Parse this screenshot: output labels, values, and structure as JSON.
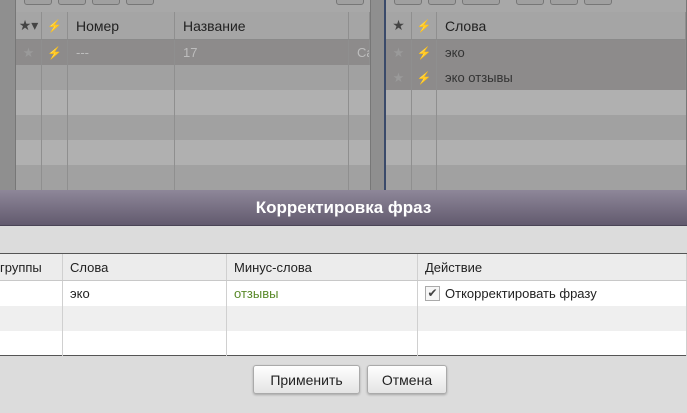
{
  "left_grid": {
    "headers": {
      "star": "★▾",
      "bolt": "⚡",
      "number": "Номер",
      "name": "Название"
    },
    "rows": [
      {
        "number": "---",
        "name": "17",
        "extra": "Ca"
      }
    ]
  },
  "right_grid": {
    "headers": {
      "star": "★",
      "bolt": "⚡",
      "words": "Слова"
    },
    "rows": [
      {
        "words": "эко"
      },
      {
        "words": "эко отзывы"
      }
    ]
  },
  "dialog": {
    "title": "Корректировка фраз",
    "columns": [
      "группы",
      "Слова",
      "Минус-слова",
      "Действие"
    ],
    "rows": [
      {
        "group": "",
        "words": "эко",
        "minus": "отзывы",
        "action": "Откорректировать фразу",
        "checked": true
      }
    ],
    "apply": "Применить",
    "cancel": "Отмена",
    "minus_color": "#5a8a2a"
  }
}
